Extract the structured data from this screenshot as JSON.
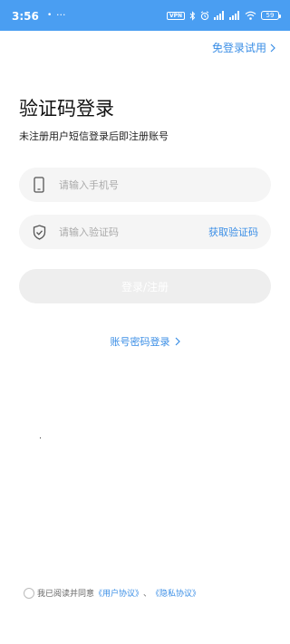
{
  "status_bar": {
    "time": "3:56",
    "notification_glyph": "•",
    "more_glyph": "···",
    "vpn_label": "VPN",
    "battery_level": "59"
  },
  "header": {
    "trial_label": "免登录试用"
  },
  "page": {
    "title": "验证码登录",
    "subtitle": "未注册用户短信登录后即注册账号"
  },
  "form": {
    "phone_placeholder": "请输入手机号",
    "code_placeholder": "请输入验证码",
    "get_code_label": "获取验证码",
    "submit_label": "登录/注册"
  },
  "alt_login": {
    "label": "账号密码登录"
  },
  "agreement": {
    "prefix": "我已阅读并同意",
    "user_agreement": "《用户协议》",
    "separator": "、",
    "privacy_policy": "《隐私协议》"
  },
  "colors": {
    "accent": "#3a8ee6",
    "status_bar": "#4a9ef2"
  }
}
